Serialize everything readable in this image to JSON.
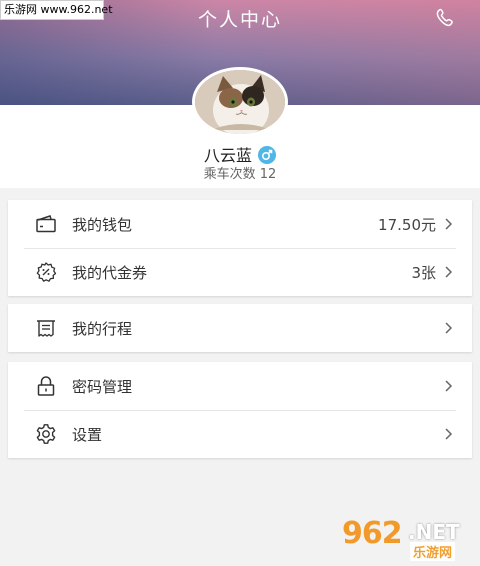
{
  "watermark": {
    "top_text": "乐游网 www.962.net",
    "bottom_num": "962",
    "bottom_net": ".NET",
    "bottom_site": "乐游网"
  },
  "header": {
    "title": "个人中心",
    "phone_icon": "phone-icon"
  },
  "profile": {
    "name": "八云蓝",
    "gender_icon": "male-icon",
    "rides_label": "乘车次数 12"
  },
  "menu": {
    "wallet": {
      "label": "我的钱包",
      "value": "17.50元",
      "icon": "wallet-icon"
    },
    "voucher": {
      "label": "我的代金券",
      "value": "3张",
      "icon": "voucher-icon"
    },
    "trips": {
      "label": "我的行程",
      "icon": "receipt-icon"
    },
    "password": {
      "label": "密码管理",
      "icon": "lock-icon"
    },
    "settings": {
      "label": "设置",
      "icon": "gear-icon"
    }
  },
  "colors": {
    "accent_blue": "#4fb6e8",
    "header_top": "#cc86a6",
    "header_bottom": "#5c5f8c"
  }
}
